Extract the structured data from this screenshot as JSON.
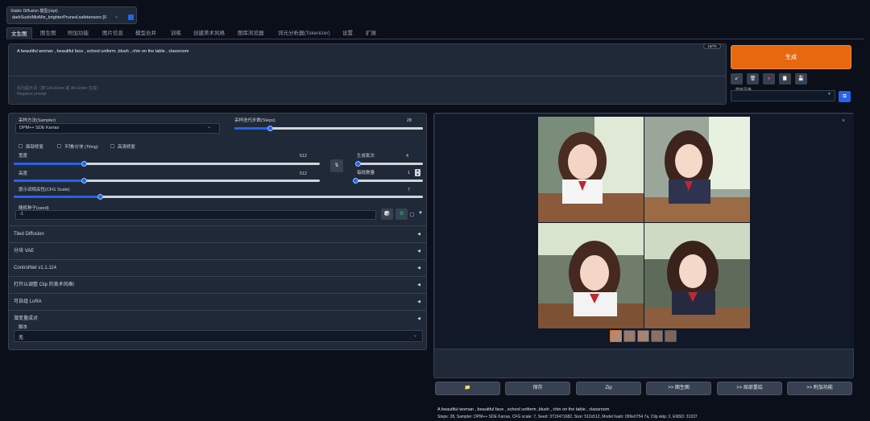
{
  "checkpoint": {
    "label": "Stable Diffusion 模型(ckpt)",
    "value": "darkSushiMixMix_brighterPruned.safetensors [0"
  },
  "tabs": [
    "文生图",
    "图生图",
    "附加功能",
    "图片信息",
    "模型合并",
    "训练",
    "创建美术风格",
    "图库浏览器",
    "词元分析器(Tokenizer)",
    "设置",
    "扩展"
  ],
  "prompt": {
    "positive": "A beautiful woman , beautiful face , school uniform ,blush , chin on the table , classroom",
    "token_count": "18/75",
    "negative_placeholder_1": "反向提示词（按 Ctrl+Enter 或 Alt+Enter 生成）",
    "negative_placeholder_2": "Negative prompt"
  },
  "generate": {
    "label": "生成"
  },
  "tools": {
    "read": "↙",
    "trash": "🗑",
    "red": "●",
    "clip": "📋",
    "save": "💾"
  },
  "styles": {
    "label": "模板风格",
    "apply": "⧉"
  },
  "sampler": {
    "label": "采样方法(Sampler)",
    "value": "DPM++ SDE Karras"
  },
  "steps": {
    "label": "采样迭代步数(Steps)",
    "value": "28",
    "fraction": 0.19
  },
  "checks": {
    "restore_faces": "面部修复",
    "tiling": "平铺/分块 (Tiling)",
    "hires_fix": "高清修复"
  },
  "width": {
    "label": "宽度",
    "value": "512",
    "fraction": 0.23
  },
  "height": {
    "label": "高度",
    "value": "512",
    "fraction": 0.23
  },
  "swap": {
    "label": "⇅"
  },
  "batch_count": {
    "label": "生成批次",
    "value": "4",
    "fraction": 0.04
  },
  "batch_size": {
    "label": "每批数量",
    "value": "1",
    "fraction": 0.0
  },
  "cfg": {
    "label": "提示词相关性(CFG Scale)",
    "value": "7",
    "fraction": 0.21
  },
  "seed": {
    "label": "随机种子(seed)",
    "value": "-1",
    "dice": "🎲",
    "recycle": "♻"
  },
  "accordions": [
    "Tiled Diffusion",
    "分块 VAE",
    "ControlNet v1.1.114",
    "打开以调整 Clip 的美术风格!",
    "可自组 LoRA",
    "潜变量成对"
  ],
  "script": {
    "label": "脚本",
    "value": "无"
  },
  "output": {
    "buttons": [
      "📁",
      "保存",
      "Zip",
      ">> 图生图",
      ">> 局部重绘",
      ">> 附加功能"
    ],
    "info_prompt": "A beautiful woman , beautiful face , school uniform ,blush , chin on the table , classroom",
    "info_params": "Steps: 28, Sampler: DPM++ SDE Karras, CFG scale: 7, Seed: 3715471682, Size: 512x512, Model hash: 099e0754 7a, Clip skip: 2, ENSD: 31337"
  },
  "colors": {
    "accent": "#2563eb",
    "generate": "#e8680f",
    "bg": "#0b0f19",
    "panel": "#1f2937"
  }
}
